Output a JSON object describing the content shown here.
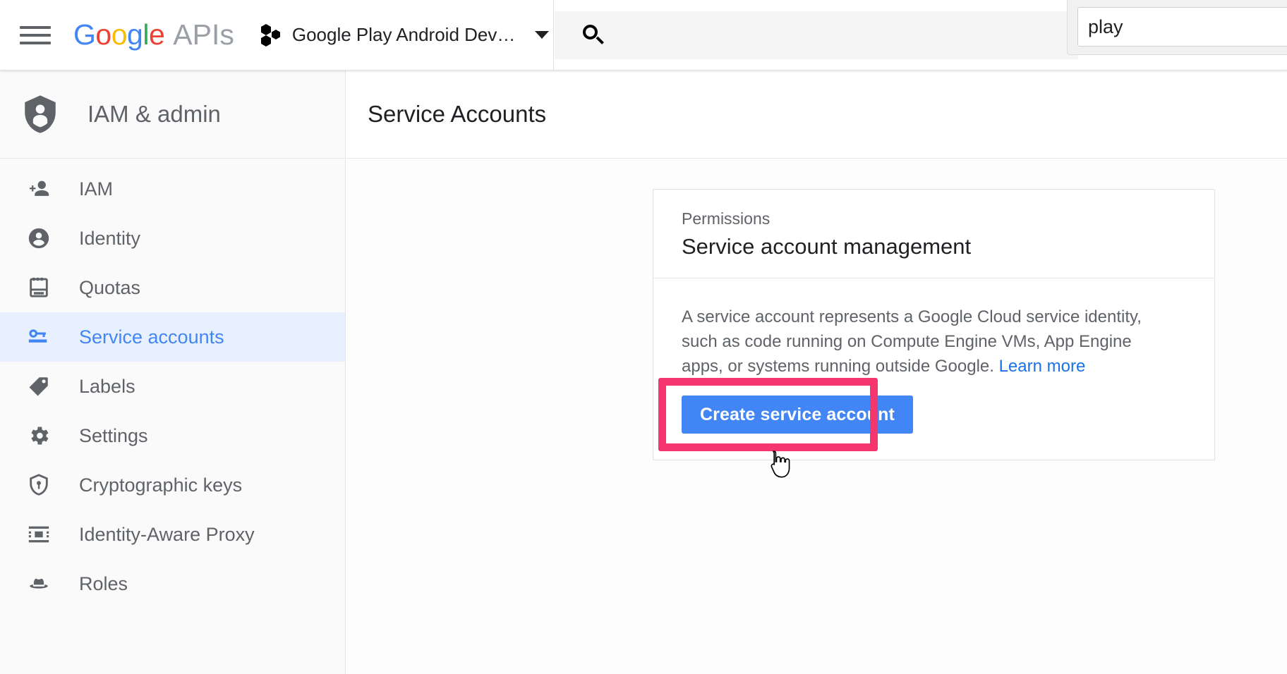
{
  "topbar": {
    "menu_icon": "hamburger-menu-icon",
    "logo_text": "Google",
    "logo_suffix": "APIs",
    "logo_letters": [
      {
        "ch": "G",
        "color": "#4285f4"
      },
      {
        "ch": "o",
        "color": "#ea4335"
      },
      {
        "ch": "o",
        "color": "#fbbc05"
      },
      {
        "ch": "g",
        "color": "#4285f4"
      },
      {
        "ch": "l",
        "color": "#34a853"
      },
      {
        "ch": "e",
        "color": "#ea4335"
      }
    ],
    "project_icon": "cloud-project-hexagons-icon",
    "project_name": "Google Play Android Dev…",
    "project_caret": "chevron-down-icon",
    "search_icon": "search-icon",
    "search_value": "",
    "search_placeholder": ""
  },
  "findbox": {
    "value": "play",
    "placeholder": ""
  },
  "sidebar": {
    "header_icon": "shield-person-icon",
    "header_title": "IAM & admin",
    "items": [
      {
        "label": "IAM",
        "icon": "person-add-icon",
        "active": false
      },
      {
        "label": "Identity",
        "icon": "account-circle-icon",
        "active": false
      },
      {
        "label": "Quotas",
        "icon": "quota-gauge-icon",
        "active": false
      },
      {
        "label": "Service accounts",
        "icon": "key-card-icon",
        "active": true
      },
      {
        "label": "Labels",
        "icon": "label-tag-icon",
        "active": false
      },
      {
        "label": "Settings",
        "icon": "gear-icon",
        "active": false
      },
      {
        "label": "Cryptographic keys",
        "icon": "shield-key-icon",
        "active": false
      },
      {
        "label": "Identity-Aware Proxy",
        "icon": "proxy-icon",
        "active": false
      },
      {
        "label": "Roles",
        "icon": "fedora-hat-icon",
        "active": false
      }
    ]
  },
  "main": {
    "page_title": "Service Accounts",
    "card": {
      "kicker": "Permissions",
      "title": "Service account management",
      "body_text": "A service account represents a Google Cloud service identity, such as code running on Compute Engine VMs, App Engine apps, or systems running outside Google. ",
      "learn_more": "Learn more",
      "button_label": "Create service account"
    }
  },
  "colors": {
    "accent_blue": "#4285f4",
    "link_blue": "#1a73e8",
    "annotation_pink": "#f5356e",
    "nav_active_bg": "#e8f0fe",
    "text_primary": "#202124",
    "text_secondary": "#5f6368"
  }
}
